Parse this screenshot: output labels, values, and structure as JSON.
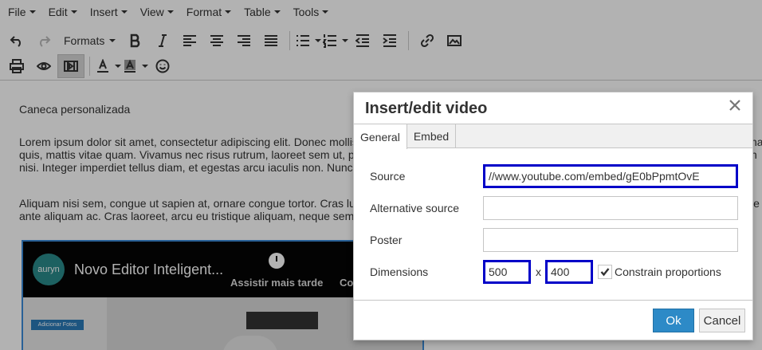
{
  "menubar": {
    "items": [
      {
        "label": "File"
      },
      {
        "label": "Edit"
      },
      {
        "label": "Insert"
      },
      {
        "label": "View"
      },
      {
        "label": "Format"
      },
      {
        "label": "Table"
      },
      {
        "label": "Tools"
      }
    ]
  },
  "toolbar": {
    "formats_label": "Formats",
    "icons": [
      "undo-icon",
      "redo-icon",
      "bold-icon",
      "italic-icon",
      "align-left-icon",
      "align-center-icon",
      "align-right-icon",
      "justify-icon",
      "bullet-list-icon",
      "numbered-list-icon",
      "outdent-icon",
      "indent-icon",
      "link-icon",
      "image-icon",
      "print-icon",
      "preview-icon",
      "media-icon",
      "text-color-icon",
      "background-color-icon",
      "emoticons-icon"
    ]
  },
  "editor": {
    "heading": "Caneca personalizada",
    "para1_lines": [
      "Lorem ipsum dolor sit amet, consectetur adipiscing elit. Donec mollis",
      "quis, mattis vitae quam. Vivamus nec risus rutrum, laoreet sem ut, pha",
      "nisi. Integer imperdiet tellus diam, et egestas arcu iaculis non. Nunc ut"
    ],
    "para1_tail_lines": [
      "na",
      "n"
    ],
    "para2_lines": [
      "Aliquam nisi sem, congue ut sapien at, ornare congue tortor. Cras luct",
      "ante aliquam ac. Cras laoreet, arcu eu tristique aliquam, neque sem vu"
    ],
    "para2_tail_lines": [
      "le"
    ],
    "video": {
      "logo_text": "auryn",
      "title": "Novo Editor Inteligent...",
      "watch_later": "Assistir mais tarde",
      "share_partial": "Co",
      "button_text": "Adicionar Fotos"
    }
  },
  "dialog": {
    "title": "Insert/edit video",
    "tabs": [
      {
        "label": "General",
        "active": true
      },
      {
        "label": "Embed",
        "active": false
      }
    ],
    "fields": {
      "source_label": "Source",
      "source_value": "//www.youtube.com/embed/gE0bPpmtOvE",
      "alt_label": "Alternative source",
      "alt_value": "",
      "poster_label": "Poster",
      "poster_value": "",
      "dimensions_label": "Dimensions",
      "width_value": "500",
      "height_value": "400",
      "x_label": "x",
      "constrain_label": "Constrain proportions",
      "constrain_checked": true
    },
    "ok_label": "Ok",
    "cancel_label": "Cancel"
  },
  "colors": {
    "ok_button": "#2d8ac7",
    "focus_border": "#0000c8",
    "video_selection": "#3b8bd9"
  }
}
